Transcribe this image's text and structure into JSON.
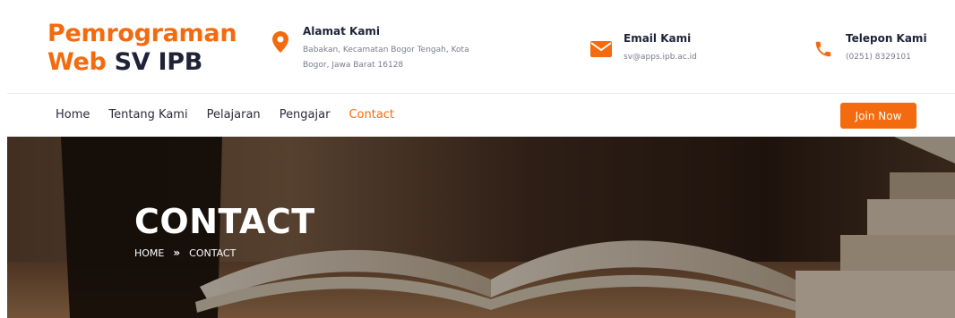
{
  "logo": {
    "line1": "Pemrograman",
    "line2_accent": "Web",
    "line2_rest": " SV IPB"
  },
  "contacts": {
    "address": {
      "title": "Alamat Kami",
      "text": "Babakan, Kecamatan Bogor Tengah, Kota Bogor, Jawa Barat 16128",
      "icon": "map-pin-icon"
    },
    "email": {
      "title": "Email Kami",
      "text": "sv@apps.ipb.ac.id",
      "icon": "envelope-icon"
    },
    "phone": {
      "title": "Telepon Kami",
      "text": "(0251) 8329101",
      "icon": "phone-icon"
    }
  },
  "nav": {
    "items": [
      "Home",
      "Tentang Kami",
      "Pelajaran",
      "Pengajar",
      "Contact"
    ],
    "active": "Contact",
    "join_label": "Join Now"
  },
  "hero": {
    "title": "CONTACT",
    "breadcrumb": {
      "home": "HOME",
      "separator": "»",
      "current": "CONTACT"
    }
  },
  "colors": {
    "accent": "#f46a0f",
    "dark": "#1f2337",
    "muted": "#7a7d8a"
  }
}
